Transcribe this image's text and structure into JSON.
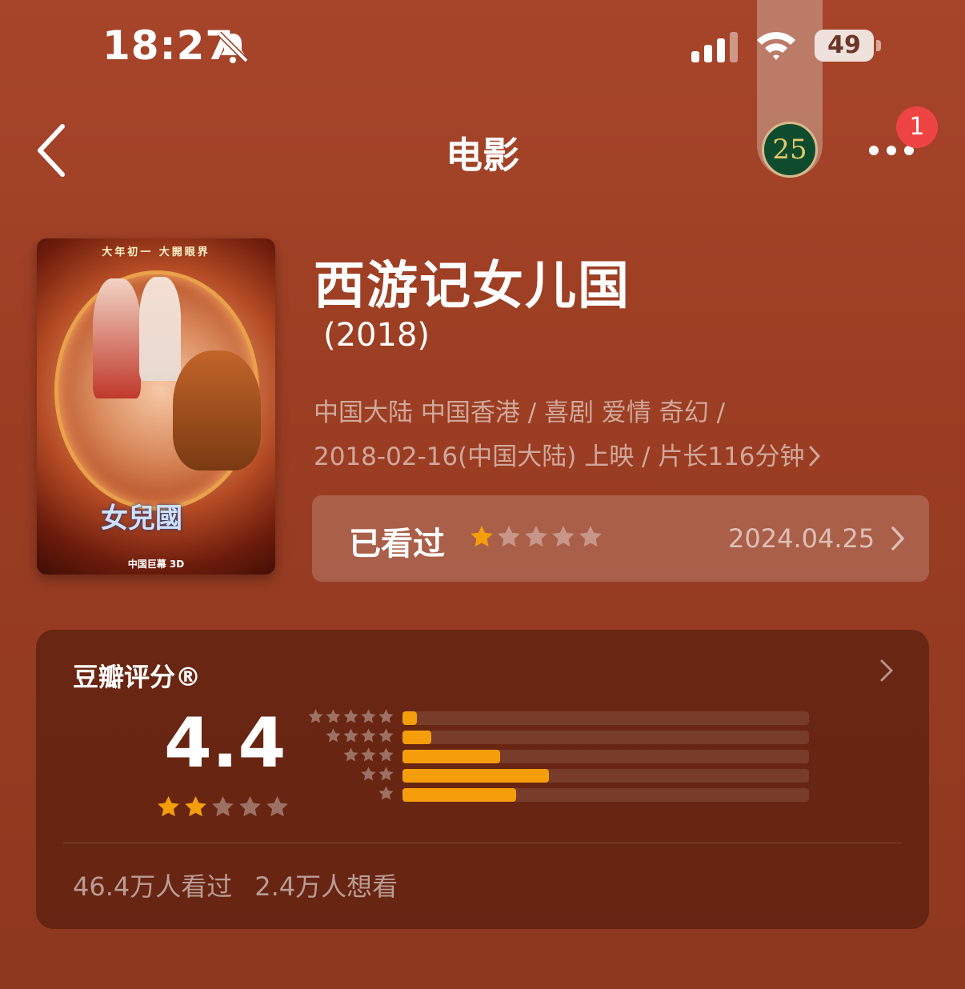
{
  "status_bar": {
    "time": "18:27",
    "battery": "49"
  },
  "nav": {
    "title": "电影",
    "badge_25": "25",
    "notification_count": "1"
  },
  "poster": {
    "top_text": "大年初一 大開眼界",
    "logo_text": "女兒國",
    "bottom_text": "中国巨幕 3D"
  },
  "movie": {
    "title": "西游记女儿国",
    "year": "(2018)",
    "meta_line1": "中国大陆 中国香港 / 喜剧 爱情 奇幻 /",
    "meta_line2": "2018-02-16(中国大陆) 上映 / 片长116分钟"
  },
  "watched": {
    "label": "已看过",
    "my_rating": 1,
    "max_stars": 5,
    "date": "2024.04.25"
  },
  "rating": {
    "title": "豆瓣评分®",
    "score": "4.4",
    "score_stars": 2,
    "distribution": [
      {
        "stars": 5,
        "fraction": 0.035
      },
      {
        "stars": 4,
        "fraction": 0.07
      },
      {
        "stars": 3,
        "fraction": 0.24
      },
      {
        "stars": 2,
        "fraction": 0.36
      },
      {
        "stars": 1,
        "fraction": 0.28
      }
    ],
    "watched_count": "46.4万人看过",
    "want_count": "2.4万人想看"
  },
  "colors": {
    "accent": "#f59e0b",
    "background": "#9a3f24",
    "badge": "#ef4444"
  },
  "icons": [
    "bell-slash-icon",
    "signal-icon",
    "wifi-icon",
    "battery-icon",
    "back-chevron-icon",
    "more-icon",
    "star-icon",
    "chevron-right-icon"
  ]
}
